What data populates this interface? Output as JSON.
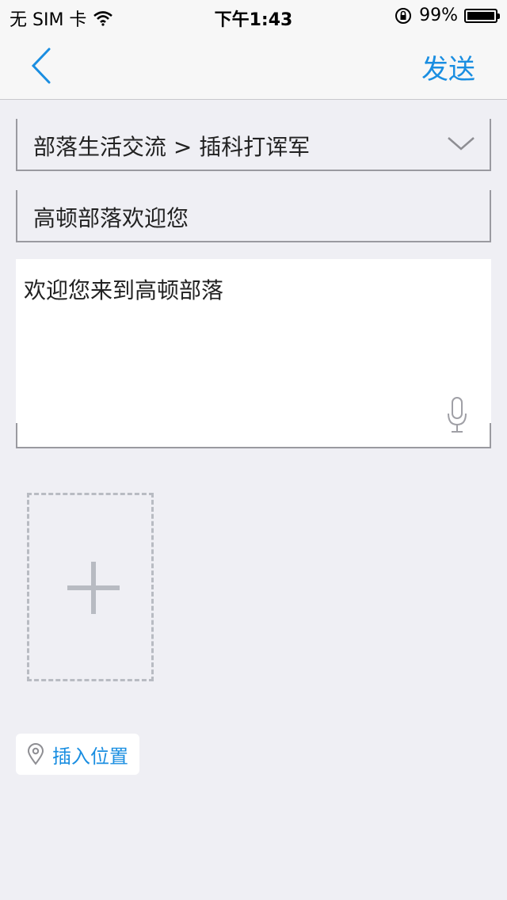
{
  "status": {
    "carrier": "无 SIM 卡",
    "time": "下午1:43",
    "battery_percent_text": "99%",
    "battery_level": 0.99
  },
  "nav": {
    "send_label": "发送"
  },
  "form": {
    "category_value": "部落生活交流 > 插科打诨军",
    "title_value": "高顿部落欢迎您",
    "content_value": "欢迎您来到高顿部落"
  },
  "location": {
    "label": "插入位置"
  },
  "colors": {
    "accent": "#1a8ee1",
    "background": "#efeff4"
  }
}
